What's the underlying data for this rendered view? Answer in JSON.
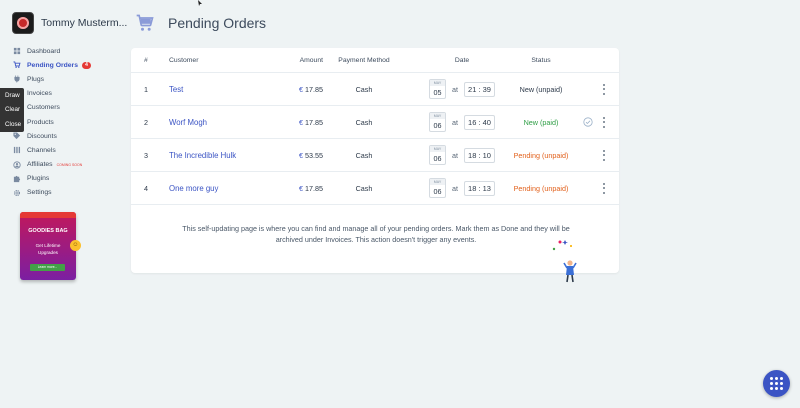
{
  "profile": {
    "name": "Tommy Musterm..."
  },
  "sidebar": {
    "items": [
      {
        "label": "Dashboard",
        "icon": "dashboard-icon"
      },
      {
        "label": "Pending Orders",
        "icon": "cart-icon",
        "badge": "4",
        "active": true
      },
      {
        "label": "Plugs",
        "icon": "plug-icon"
      },
      {
        "label": "Invoices",
        "icon": "invoice-icon"
      },
      {
        "label": "Customers",
        "icon": "users-icon"
      },
      {
        "label": "Products",
        "icon": "box-icon"
      },
      {
        "label": "Discounts",
        "icon": "tag-icon"
      },
      {
        "label": "Channels",
        "icon": "channels-icon"
      },
      {
        "label": "Affiliates",
        "icon": "affiliates-icon",
        "tag": "coming soon"
      },
      {
        "label": "Plugins",
        "icon": "puzzle-icon"
      },
      {
        "label": "Settings",
        "icon": "gear-icon"
      }
    ]
  },
  "draw_tools": {
    "draw": "Draw",
    "clear": "Clear",
    "close": "Close"
  },
  "promo": {
    "title": "GOODIES BAG",
    "subtitle": "Get Lifetime Upgrades",
    "button": "Learn more..."
  },
  "header": {
    "title": "Pending Orders"
  },
  "table": {
    "columns": {
      "num": "#",
      "customer": "Customer",
      "amount": "Amount",
      "payment": "Payment Method",
      "date": "Date",
      "status": "Status"
    },
    "rows": [
      {
        "num": "1",
        "customer": "Test",
        "currency": "€",
        "amount": "17.85",
        "payment": "Cash",
        "month": "MAY",
        "day": "05",
        "at": "at",
        "time": "21 : 39",
        "status": "New (unpaid)",
        "status_type": "new",
        "checked": false
      },
      {
        "num": "2",
        "customer": "Worf Mogh",
        "currency": "€",
        "amount": "17.85",
        "payment": "Cash",
        "month": "MAY",
        "day": "06",
        "at": "at",
        "time": "16 : 40",
        "status": "New (paid)",
        "status_type": "paid",
        "checked": true
      },
      {
        "num": "3",
        "customer": "The Incredible Hulk",
        "currency": "€",
        "amount": "53.55",
        "payment": "Cash",
        "month": "MAY",
        "day": "06",
        "at": "at",
        "time": "18 : 10",
        "status": "Pending (unpaid)",
        "status_type": "pending",
        "checked": false
      },
      {
        "num": "4",
        "customer": "One more guy",
        "currency": "€",
        "amount": "17.85",
        "payment": "Cash",
        "month": "MAY",
        "day": "06",
        "at": "at",
        "time": "18 : 13",
        "status": "Pending (unpaid)",
        "status_type": "pending",
        "checked": false
      }
    ]
  },
  "info_text": "This self-updating page is where you can find and manage all of your pending orders. Mark them as Done and they will be archived under Invoices. This action doesn't trigger any events.",
  "colors": {
    "accent": "#3b54c4",
    "paid": "#2e9e45",
    "pending": "#e2611c",
    "badge": "#e53935"
  }
}
